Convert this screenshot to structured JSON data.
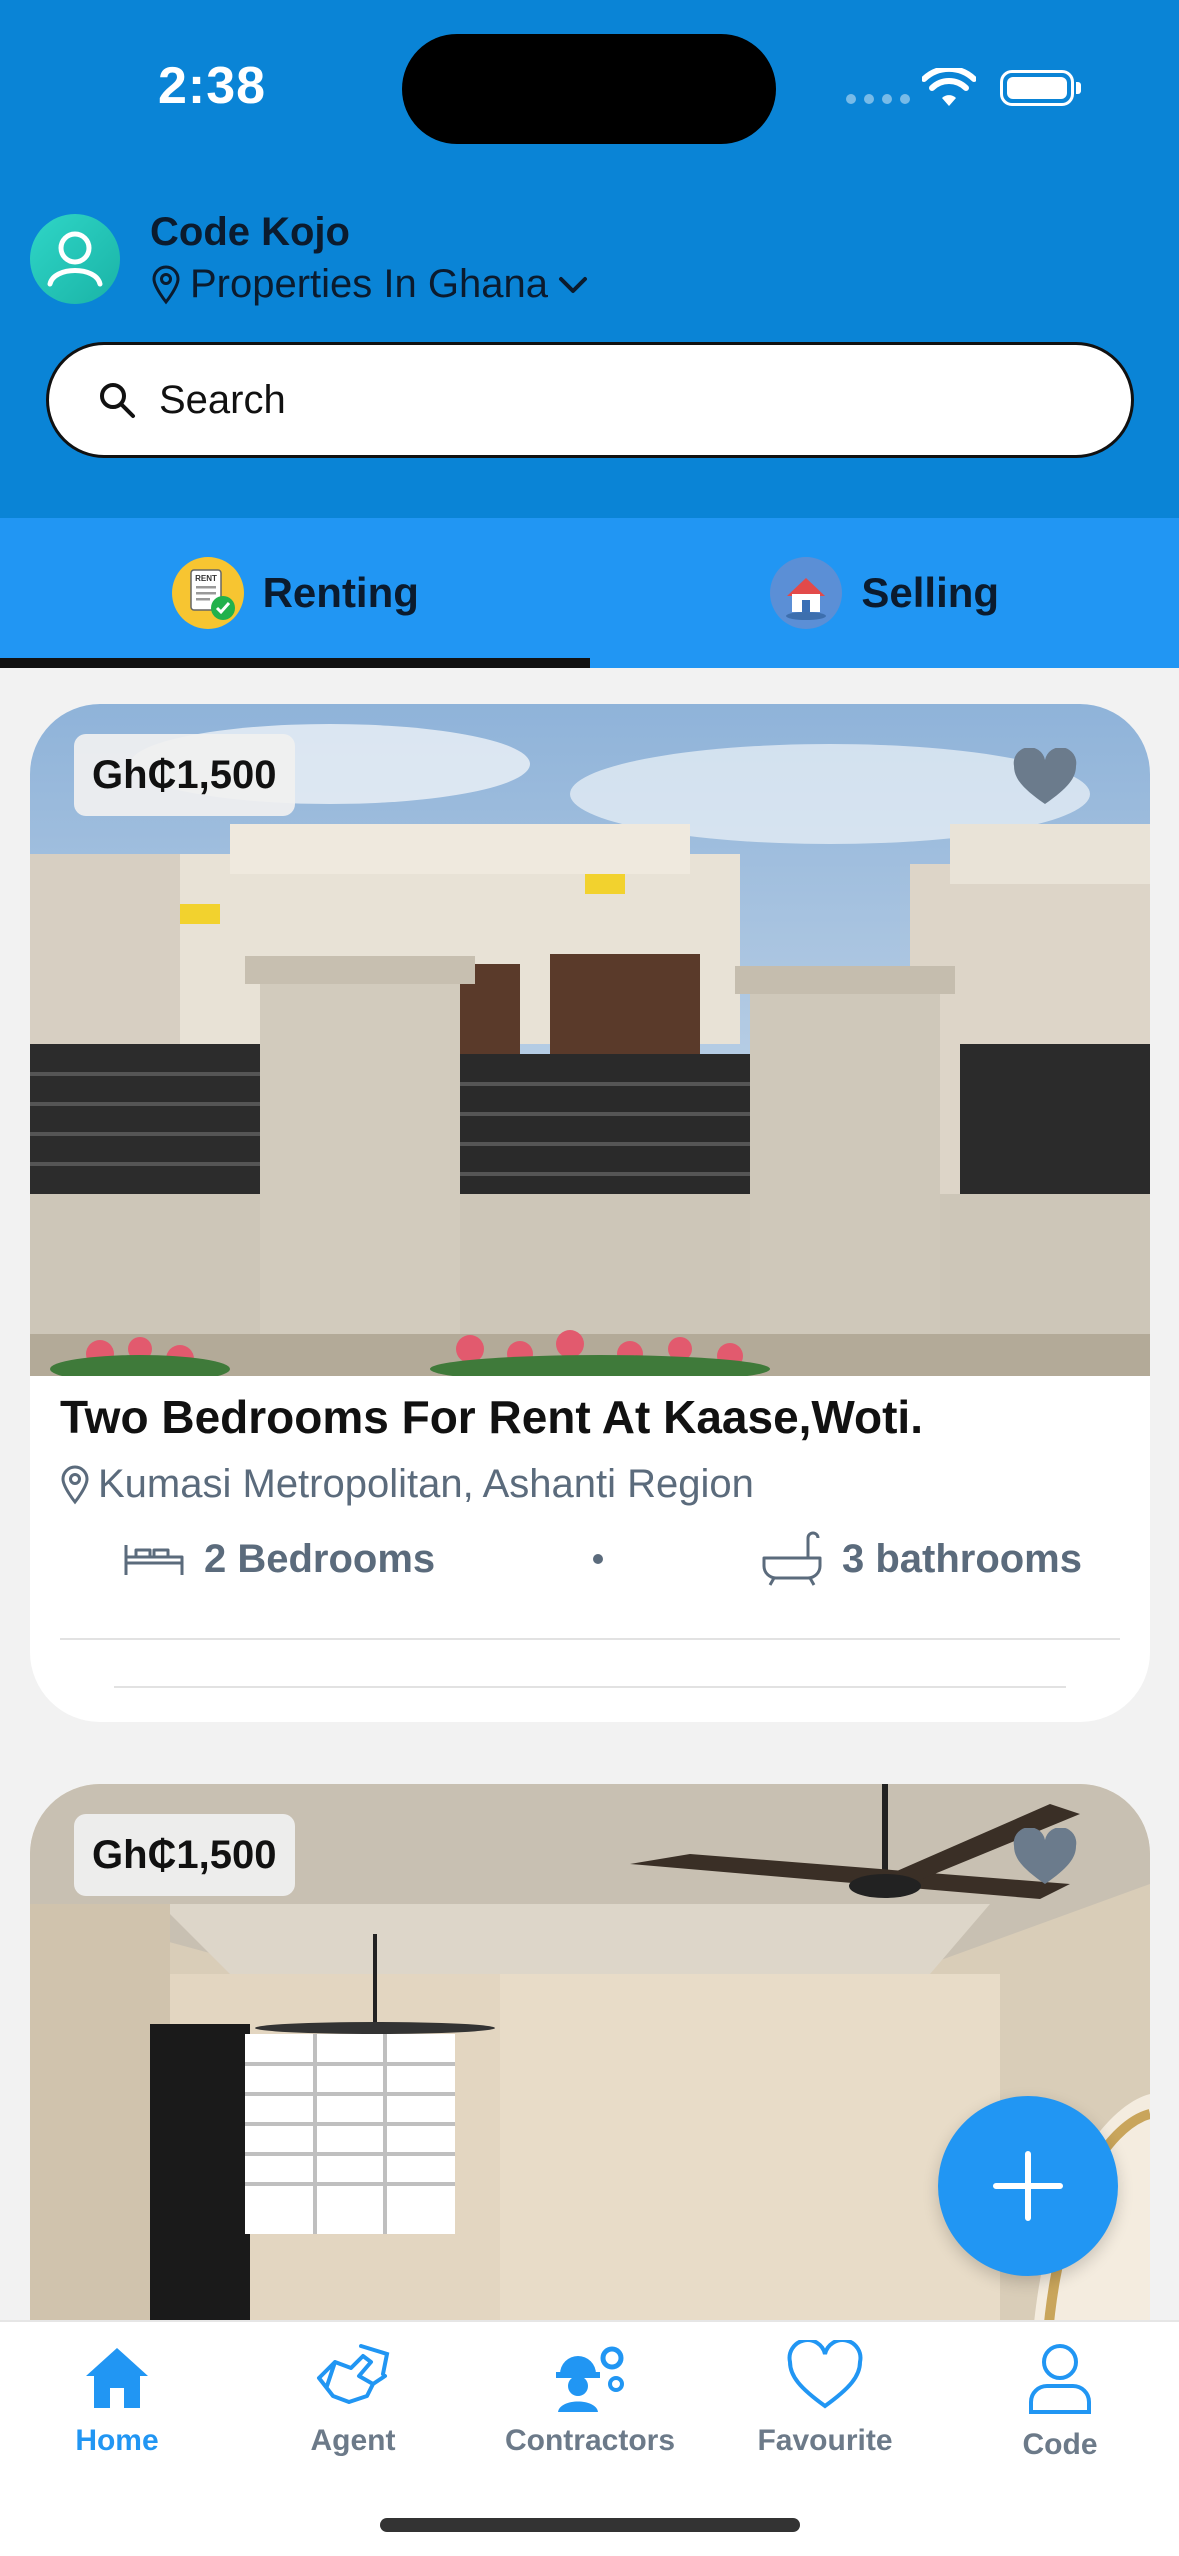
{
  "status_bar": {
    "time": "2:38"
  },
  "header": {
    "user_name": "Code Kojo",
    "location": "Properties In Ghana",
    "avatar_icon": "user-icon",
    "location_icon": "map-pin-icon",
    "dropdown_icon": "chevron-down-icon"
  },
  "search": {
    "placeholder": "Search",
    "icon": "search-icon"
  },
  "tabs": [
    {
      "label": "Renting",
      "active": true
    },
    {
      "label": "Selling",
      "active": false
    }
  ],
  "listings": [
    {
      "price": "Gh₵1,500",
      "title": "Two Bedrooms For Rent At Kaase,Woti.",
      "location": "Kumasi Metropolitan, Ashanti Region",
      "bedrooms": "2 Bedrooms",
      "bathrooms": "3 bathrooms",
      "favorite": false
    },
    {
      "price": "Gh₵1,500",
      "favorite": false
    }
  ],
  "fab": {
    "icon": "plus-icon"
  },
  "bottom_nav": [
    {
      "label": "Home",
      "icon": "home-icon",
      "active": true
    },
    {
      "label": "Agent",
      "icon": "agent-icon",
      "active": false
    },
    {
      "label": "Contractors",
      "icon": "contractor-icon",
      "active": false
    },
    {
      "label": "Favourite",
      "icon": "heart-icon",
      "active": false
    },
    {
      "label": "Code",
      "icon": "profile-icon",
      "active": false
    }
  ],
  "colors": {
    "header_blue": "#0a84d6",
    "tab_blue": "#2196f3",
    "accent": "#2196f3",
    "muted_text": "#5b6b7c"
  }
}
